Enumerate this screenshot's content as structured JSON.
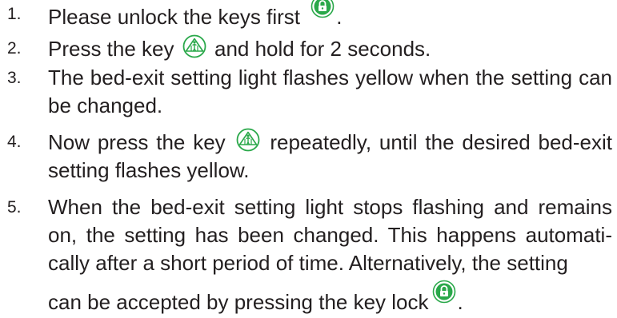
{
  "colors": {
    "text": "#231f20",
    "icon_green": "#2aa84a"
  },
  "icons": {
    "lock": "lock-icon",
    "bed_exit": "bed-exit-key-icon"
  },
  "steps": [
    {
      "number": "1.",
      "text_a": "Please unlock the keys first",
      "text_b": "."
    },
    {
      "number": "2.",
      "text_a": "Press the key",
      "text_b": "and hold for 2 seconds."
    },
    {
      "number": "3.",
      "text_a": "The bed-exit setting light flashes yellow when the setting can be changed."
    },
    {
      "number": "4.",
      "text_a": "Now press the key",
      "text_b": "repeatedly, until the desired bed-exit setting flashes yellow."
    },
    {
      "number": "5.",
      "text_a": "When the bed-exit setting light stops flashing and remains on, the setting has been changed. This happens automati-cally after a short period of time. Alternatively, the setting",
      "text_b": "can be accepted by pressing the key lock",
      "text_c": "."
    }
  ]
}
